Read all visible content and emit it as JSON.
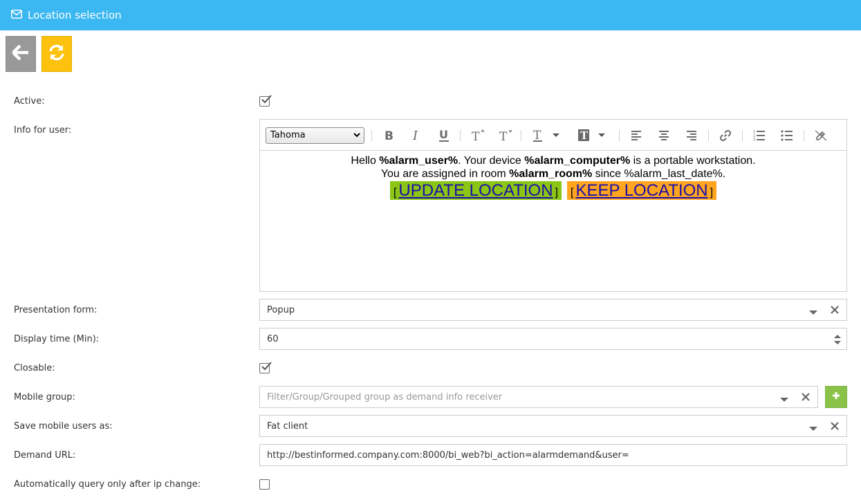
{
  "header": {
    "title": "Location selection",
    "icon": "envelope-icon",
    "color": "#3bb8f2"
  },
  "toolbar": {
    "back_icon": "arrow-left-icon",
    "refresh_icon": "refresh-icon"
  },
  "form": {
    "active": {
      "label": "Active:",
      "checked": true
    },
    "info": {
      "label": "Info for user:",
      "font": "Tahoma",
      "line1": {
        "t1": "Hello ",
        "b1": "%alarm_user%",
        "t2": ". Your device ",
        "b2": "%alarm_computer%",
        "t3": " is a portable workstation."
      },
      "line2": {
        "t1": "You are assigned in room ",
        "b1": "%alarm_room%",
        "t2": " since %alarm_last_date%."
      },
      "update_link": "UPDATE LOCATION",
      "keep_link": "KEEP LOCATION",
      "bracket_open": "[",
      "bracket_close": "]"
    },
    "presentation": {
      "label": "Presentation form:",
      "value": "Popup"
    },
    "display_time": {
      "label": "Display time (Min):",
      "value": "60"
    },
    "closable": {
      "label": "Closable:",
      "checked": true
    },
    "mobile_group": {
      "label": "Mobile group:",
      "placeholder": "Filter/Group/Grouped group as demand info receiver"
    },
    "save_mobile": {
      "label": "Save mobile users as:",
      "value": "Fat client"
    },
    "demand_url": {
      "label": "Demand URL:",
      "value": "http://bestinformed.company.com:8000/bi_web?bi_action=alarmdemand&user="
    },
    "auto_query": {
      "label": "Automatically query only after ip change:",
      "checked": false
    }
  },
  "colors": {
    "accent": "#3bb8f2",
    "back_btn": "#999999",
    "refresh_btn": "#fcc20e",
    "add_btn": "#8bc34a",
    "link_green": "#8bc515",
    "link_orange": "#ffa51f"
  }
}
